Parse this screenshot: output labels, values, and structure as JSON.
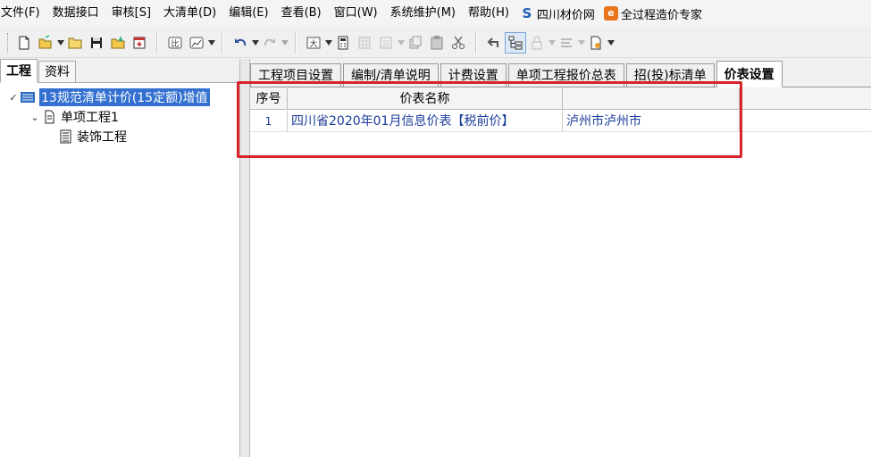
{
  "menu": [
    "文件(F)",
    "数据接口",
    "审核[S]",
    "大清单(D)",
    "编辑(E)",
    "查看(B)",
    "窗口(W)",
    "系统维护(M)",
    "帮助(H)"
  ],
  "links": {
    "sichuan": "四川材价网",
    "expert": "全过程造价专家"
  },
  "left_tabs": [
    "工程",
    "资料"
  ],
  "tree": {
    "root": "13规范清单计价(15定额)增值",
    "child": "单项工程1",
    "grandchild": "装饰工程"
  },
  "right_tabs": [
    "工程项目设置",
    "编制/清单说明",
    "计费设置",
    "单项工程报价总表",
    "招(投)标清单",
    "价表设置"
  ],
  "grid": {
    "headers": [
      "序号",
      "价表名称",
      ""
    ],
    "rows": [
      {
        "no": "1",
        "name": "四川省2020年01月信息价表【税前价】",
        "region": "泸州市泸州市"
      }
    ]
  },
  "colors": {
    "highlight": "#d8232a",
    "selection": "#3370d0",
    "link_text": "#1a3c9a"
  }
}
